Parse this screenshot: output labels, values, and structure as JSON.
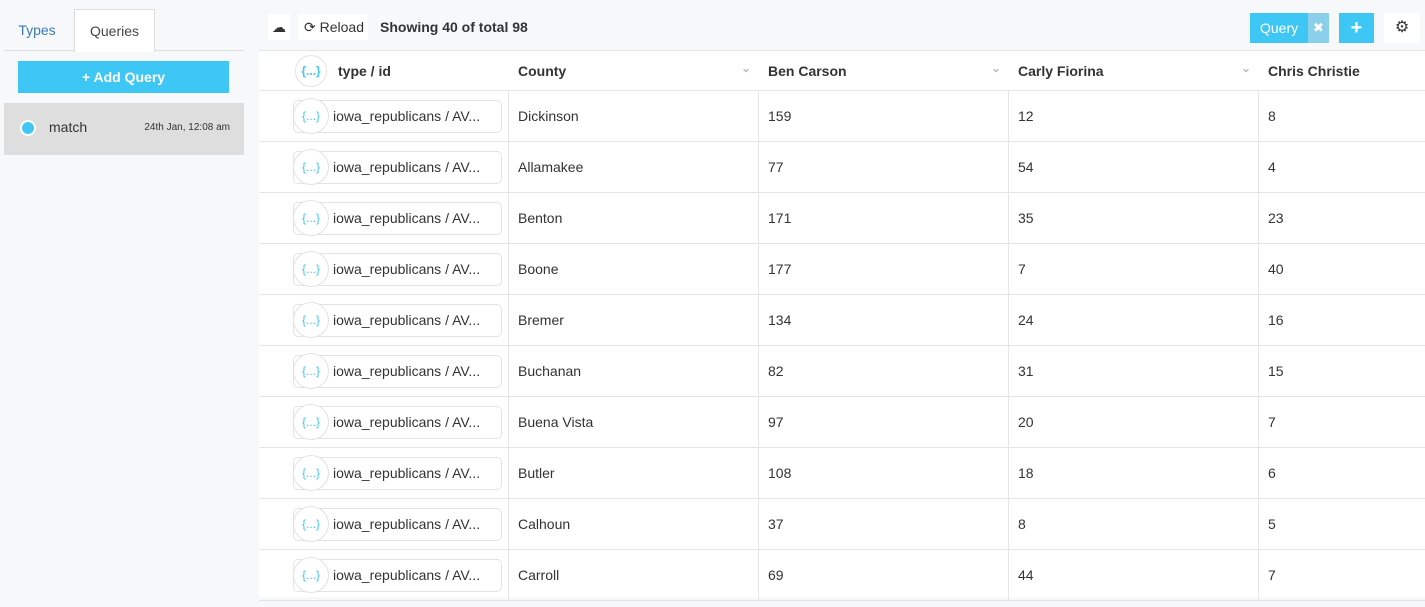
{
  "sidebar": {
    "tabs": [
      "Types",
      "Queries"
    ],
    "add_query": "+ Add Query",
    "queries": [
      {
        "name": "match",
        "time": "24th Jan, 12:08 am"
      }
    ]
  },
  "toolbar": {
    "reload": "Reload",
    "showing": "Showing 40 of total 98",
    "query_label": "Query",
    "query_close": "✖",
    "plus": "+",
    "gear": "⚙",
    "download": "☁"
  },
  "table": {
    "brace": "{...}",
    "columns": [
      "type / id",
      "County",
      "Ben Carson",
      "Carly Fiorina",
      "Chris Christie"
    ],
    "rows": [
      {
        "id": "iowa_republicans / AV...",
        "county": "Dickinson",
        "carson": "159",
        "fiorina": "12",
        "christie": "8"
      },
      {
        "id": "iowa_republicans / AV...",
        "county": "Allamakee",
        "carson": "77",
        "fiorina": "54",
        "christie": "4"
      },
      {
        "id": "iowa_republicans / AV...",
        "county": "Benton",
        "carson": "171",
        "fiorina": "35",
        "christie": "23"
      },
      {
        "id": "iowa_republicans / AV...",
        "county": "Boone",
        "carson": "177",
        "fiorina": "7",
        "christie": "40"
      },
      {
        "id": "iowa_republicans / AV...",
        "county": "Bremer",
        "carson": "134",
        "fiorina": "24",
        "christie": "16"
      },
      {
        "id": "iowa_republicans / AV...",
        "county": "Buchanan",
        "carson": "82",
        "fiorina": "31",
        "christie": "15"
      },
      {
        "id": "iowa_republicans / AV...",
        "county": "Buena Vista",
        "carson": "97",
        "fiorina": "20",
        "christie": "7"
      },
      {
        "id": "iowa_republicans / AV...",
        "county": "Butler",
        "carson": "108",
        "fiorina": "18",
        "christie": "6"
      },
      {
        "id": "iowa_republicans / AV...",
        "county": "Calhoun",
        "carson": "37",
        "fiorina": "8",
        "christie": "5"
      },
      {
        "id": "iowa_republicans / AV...",
        "county": "Carroll",
        "carson": "69",
        "fiorina": "44",
        "christie": "7"
      }
    ]
  }
}
